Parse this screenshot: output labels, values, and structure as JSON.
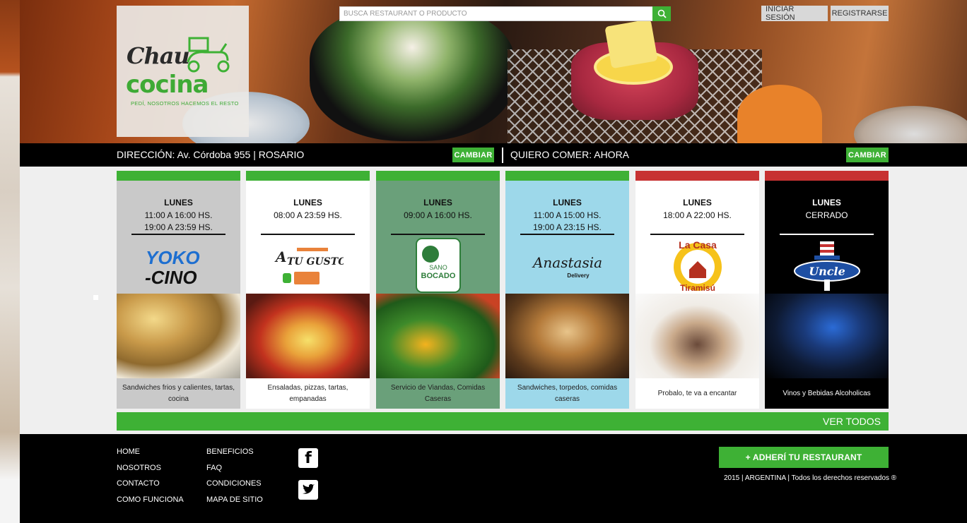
{
  "search": {
    "placeholder": "BUSCÁ RESTAURANT O PRODUCTO"
  },
  "auth": {
    "login": "INICIAR SESIÓN",
    "register": "REGISTRARSE"
  },
  "logo": {
    "line1": "Chau",
    "line2": "cocina",
    "tagline": "PEDÍ, NOSOTROS HACEMOS EL RESTO"
  },
  "address_bar": {
    "address": "DIRECCIÓN: Av. Córdoba 955 | ROSARIO",
    "change1": "CAMBIAR",
    "want": "QUIERO COMER: AHORA",
    "change2": "CAMBIAR"
  },
  "restaurants": [
    {
      "day": "LUNES",
      "hours": "11:00 A 16:00 HS.\n19:00 A 23:59 HS.",
      "logo_text": "YOKO -CINO",
      "description": "Sandwiches frios y calientes, tartas, cocina",
      "bar_color": "#3eb135"
    },
    {
      "day": "LUNES",
      "hours": "08:00 A 23:59 HS.",
      "logo_text": "A TU GUSTO !",
      "description": "Ensaladas, pizzas, tartas, empanadas",
      "bar_color": "#3eb135"
    },
    {
      "day": "LUNES",
      "hours": "09:00 A 16:00 HS.",
      "logo_text": "SANO BOCADO",
      "description": "Servicio de Viandas, Comidas Caseras",
      "bar_color": "#3eb135"
    },
    {
      "day": "LUNES",
      "hours": "11:00 A 15:00 HS.\n19:00 A 23:15 HS.",
      "logo_text": "Anastasia Delivery",
      "description": "Sandwiches, torpedos, comidas caseras",
      "bar_color": "#3eb135"
    },
    {
      "day": "LUNES",
      "hours": "18:00 A 22:00 HS.",
      "logo_text": "La Casa del Tiramisú",
      "description": "Probalo, te va a encantar",
      "bar_color": "#c73232"
    },
    {
      "day": "LUNES",
      "hours": "CERRADO",
      "logo_text": "Uncle Sam",
      "description": "Vinos y Bebidas Alcoholicas",
      "bar_color": "#c73232"
    }
  ],
  "view_all": "VER TODOS",
  "footer": {
    "col1": [
      "HOME",
      "NOSOTROS",
      "CONTACTO",
      "COMO FUNCIONA"
    ],
    "col2": [
      "BENEFICIOS",
      "FAQ",
      "CONDICIONES",
      "MAPA DE SITIO"
    ],
    "adhere": "+ ADHERÍ TU RESTAURANT",
    "copyright": "2015 | ARGENTINA | Todos los derechos reservados ®"
  },
  "icons": {
    "search": "search-icon",
    "facebook": "facebook-icon",
    "twitter": "twitter-icon"
  },
  "colors": {
    "brand_green": "#3eb135",
    "alert_red": "#c73232",
    "dark": "#000000"
  }
}
